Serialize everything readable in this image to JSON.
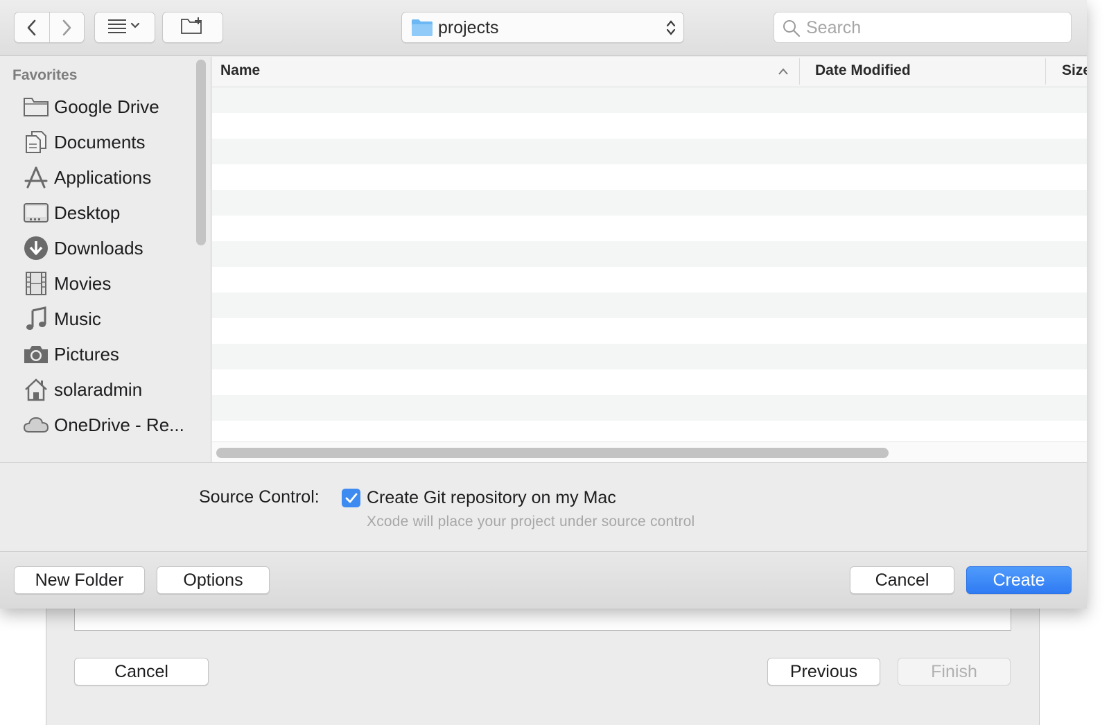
{
  "toolbar": {
    "back_icon": "chevron-left-icon",
    "forward_icon": "chevron-right-icon",
    "view_options_icon": "list-view-icon",
    "new_folder_icon": "new-folder-icon",
    "path_popup": {
      "label": "projects",
      "icon": "folder-icon"
    },
    "search": {
      "placeholder": "Search",
      "icon": "search-icon"
    }
  },
  "sidebar": {
    "heading": "Favorites",
    "items": [
      {
        "label": "Google Drive",
        "icon": "folder-icon"
      },
      {
        "label": "Documents",
        "icon": "documents-icon"
      },
      {
        "label": "Applications",
        "icon": "applications-icon"
      },
      {
        "label": "Desktop",
        "icon": "desktop-icon"
      },
      {
        "label": "Downloads",
        "icon": "downloads-icon"
      },
      {
        "label": "Movies",
        "icon": "movies-icon"
      },
      {
        "label": "Music",
        "icon": "music-icon"
      },
      {
        "label": "Pictures",
        "icon": "camera-icon"
      },
      {
        "label": "solaradmin",
        "icon": "home-icon"
      },
      {
        "label": "OneDrive - Re...",
        "icon": "cloud-icon"
      }
    ]
  },
  "file_list": {
    "columns": [
      "Name",
      "Date Modified",
      "Size"
    ],
    "sort_column": "Name",
    "sort_direction": "ascending",
    "rows": []
  },
  "source_control": {
    "label": "Source Control:",
    "checkbox_label": "Create Git repository on my Mac",
    "checked": true,
    "hint": "Xcode will place your project under source control"
  },
  "sheet_buttons": {
    "new_folder": "New Folder",
    "options": "Options",
    "cancel": "Cancel",
    "create": "Create"
  },
  "underlying_window": {
    "cancel": "Cancel",
    "previous": "Previous",
    "finish": "Finish"
  },
  "colors": {
    "accent": "#3d8bf0",
    "primary_button": "#2f7bf3",
    "sidebar_bg": "#ececec",
    "stripe": "#f4f5f5"
  }
}
